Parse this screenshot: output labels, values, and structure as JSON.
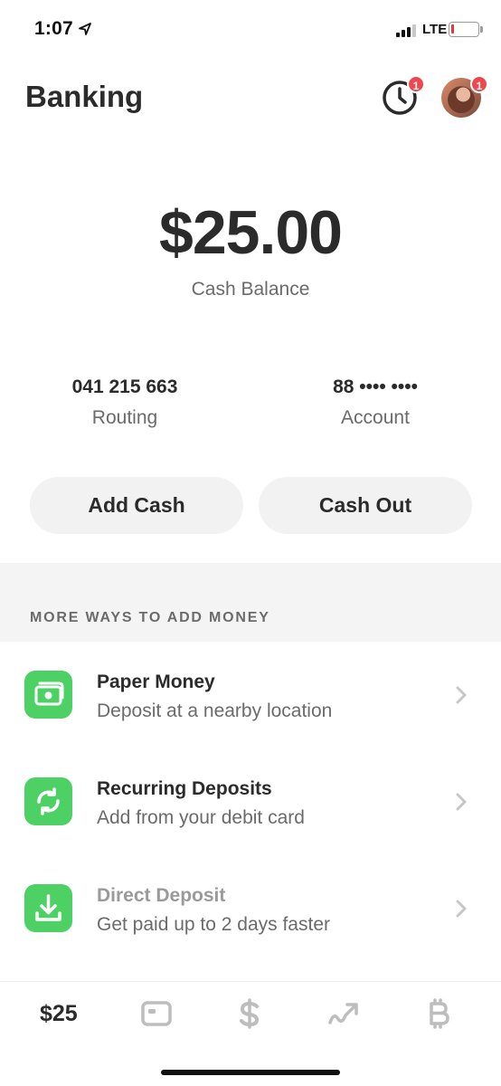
{
  "status_bar": {
    "time": "1:07",
    "carrier": "LTE"
  },
  "header": {
    "title": "Banking",
    "activity_badge": "1",
    "profile_badge": "1"
  },
  "balance": {
    "amount": "$25.00",
    "label": "Cash Balance"
  },
  "routing": {
    "value": "041 215 663",
    "label": "Routing"
  },
  "account": {
    "value": "88 •••• ••••",
    "label": "Account"
  },
  "actions": {
    "add_cash": "Add Cash",
    "cash_out": "Cash Out"
  },
  "more_ways": {
    "title": "MORE WAYS TO ADD MONEY",
    "items": [
      {
        "title": "Paper Money",
        "subtitle": "Deposit at a nearby location",
        "icon": "cash-icon"
      },
      {
        "title": "Recurring Deposits",
        "subtitle": "Add from your debit card",
        "icon": "recurring-icon"
      },
      {
        "title": "Direct Deposit",
        "subtitle": "Get paid up to 2 days faster",
        "icon": "download-icon"
      }
    ]
  },
  "tab_bar": {
    "balance_label": "$25",
    "tabs": [
      "card-icon",
      "dollar-icon",
      "investing-icon",
      "bitcoin-icon"
    ]
  },
  "colors": {
    "accent_green": "#4ed164",
    "badge_red": "#f0474e",
    "text_dark": "#2b2b2b",
    "text_muted": "#6b6b6b"
  }
}
